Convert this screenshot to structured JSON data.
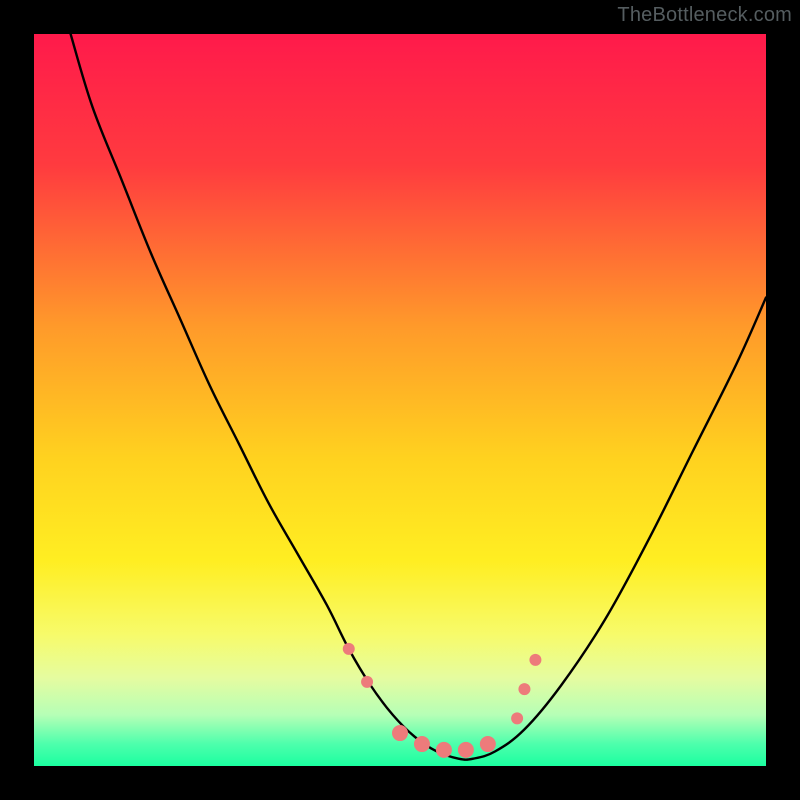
{
  "watermark": "TheBottleneck.com",
  "chart_data": {
    "type": "line",
    "title": "",
    "xlabel": "",
    "ylabel": "",
    "xlim": [
      0,
      100
    ],
    "ylim": [
      0,
      100
    ],
    "background_gradient": {
      "stops": [
        {
          "offset": 0,
          "color": "#ff1a4b"
        },
        {
          "offset": 18,
          "color": "#ff3b3f"
        },
        {
          "offset": 40,
          "color": "#ff9a2a"
        },
        {
          "offset": 58,
          "color": "#ffd21f"
        },
        {
          "offset": 72,
          "color": "#ffee22"
        },
        {
          "offset": 82,
          "color": "#f7fb6a"
        },
        {
          "offset": 88,
          "color": "#e5fca0"
        },
        {
          "offset": 93,
          "color": "#b6ffb6"
        },
        {
          "offset": 97,
          "color": "#4dffac"
        },
        {
          "offset": 100,
          "color": "#1bffa0"
        }
      ]
    },
    "series": [
      {
        "name": "bottleneck-curve",
        "x": [
          5,
          8,
          12,
          16,
          20,
          24,
          28,
          32,
          36,
          40,
          43,
          46,
          49,
          52,
          55,
          58,
          60,
          63,
          67,
          72,
          78,
          84,
          90,
          96,
          100
        ],
        "y": [
          100,
          90,
          80,
          70,
          61,
          52,
          44,
          36,
          29,
          22,
          16,
          11,
          7,
          4,
          2,
          1,
          1,
          2,
          5,
          11,
          20,
          31,
          43,
          55,
          64
        ]
      }
    ],
    "markers": [
      {
        "name": "marker-left-1",
        "x": 43.0,
        "y": 16.0
      },
      {
        "name": "marker-left-2",
        "x": 45.5,
        "y": 11.5
      },
      {
        "name": "marker-flat-1",
        "x": 50.0,
        "y": 4.5
      },
      {
        "name": "marker-flat-2",
        "x": 53.0,
        "y": 3.0
      },
      {
        "name": "marker-flat-3",
        "x": 56.0,
        "y": 2.2
      },
      {
        "name": "marker-flat-4",
        "x": 59.0,
        "y": 2.2
      },
      {
        "name": "marker-flat-5",
        "x": 62.0,
        "y": 3.0
      },
      {
        "name": "marker-right-1",
        "x": 66.0,
        "y": 6.5
      },
      {
        "name": "marker-right-2",
        "x": 67.0,
        "y": 10.5
      },
      {
        "name": "marker-right-3",
        "x": 68.5,
        "y": 14.5
      }
    ],
    "marker_style": {
      "fill": "#ed7b7b",
      "radius_small": 6,
      "radius_large": 8
    },
    "curve_style": {
      "stroke": "#000000",
      "width": 2.4
    }
  }
}
